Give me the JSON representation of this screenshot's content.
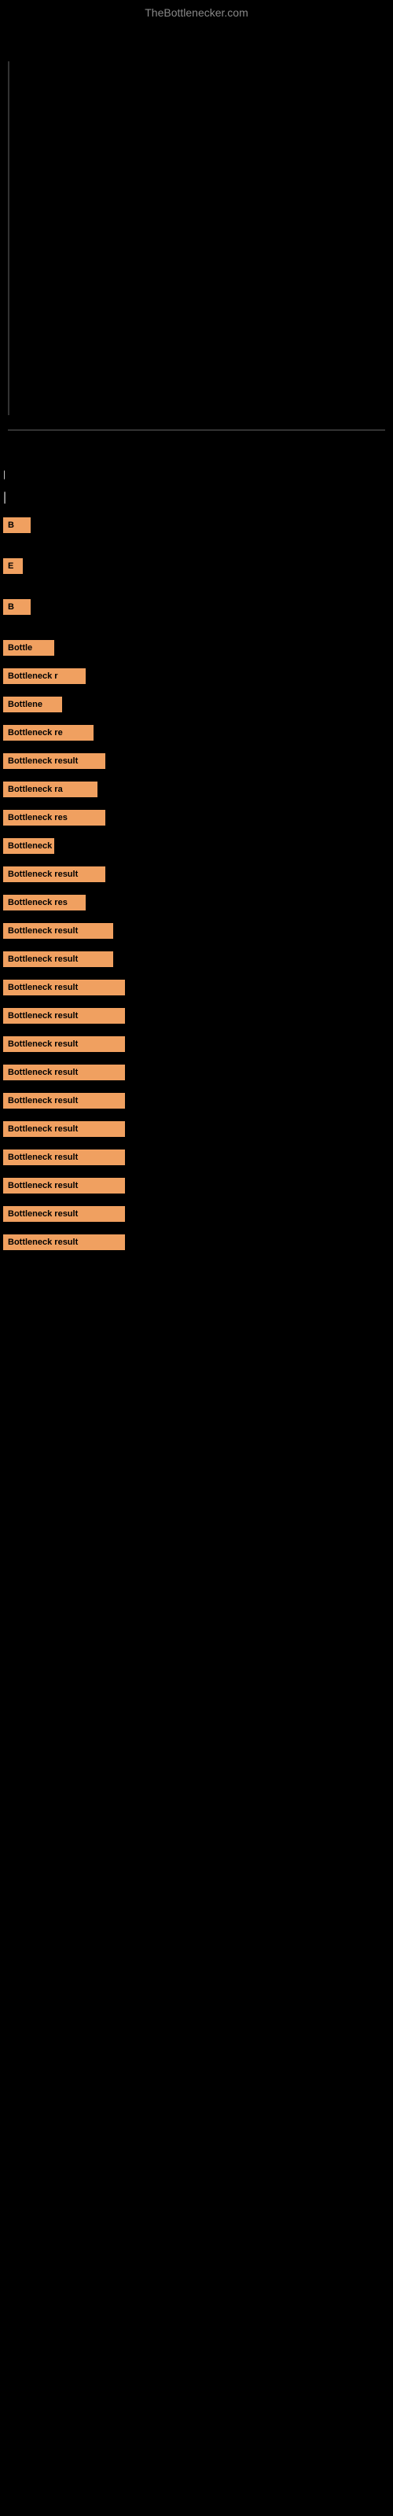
{
  "header": {
    "site_title": "TheBottlenecker.com"
  },
  "bars": [
    {
      "id": 1,
      "label": "B",
      "width_class": "bar-w1",
      "gap": "large"
    },
    {
      "id": 2,
      "label": "E",
      "width_class": "bar-w2",
      "gap": "large"
    },
    {
      "id": 3,
      "label": "B",
      "width_class": "bar-w3",
      "gap": "large"
    },
    {
      "id": 4,
      "label": "Bottle",
      "width_class": "bar-w4",
      "gap": "medium"
    },
    {
      "id": 5,
      "label": "Bottleneck r",
      "width_class": "bar-w5",
      "gap": "medium"
    },
    {
      "id": 6,
      "label": "Bottlene",
      "width_class": "bar-w6",
      "gap": "medium"
    },
    {
      "id": 7,
      "label": "Bottleneck re",
      "width_class": "bar-w7",
      "gap": "medium"
    },
    {
      "id": 8,
      "label": "Bottleneck result",
      "width_class": "bar-w8",
      "gap": "medium"
    },
    {
      "id": 9,
      "label": "Bottleneck ra",
      "width_class": "bar-w9",
      "gap": "medium"
    },
    {
      "id": 10,
      "label": "Bottleneck res",
      "width_class": "bar-w10",
      "gap": "medium"
    },
    {
      "id": 11,
      "label": "Bottleneck",
      "width_class": "bar-w11",
      "gap": "medium"
    },
    {
      "id": 12,
      "label": "Bottleneck result",
      "width_class": "bar-w12",
      "gap": "medium"
    },
    {
      "id": 13,
      "label": "Bottleneck res",
      "width_class": "bar-w13",
      "gap": "medium"
    },
    {
      "id": 14,
      "label": "Bottleneck result",
      "width_class": "bar-w14",
      "gap": "medium"
    },
    {
      "id": 15,
      "label": "Bottleneck result",
      "width_class": "bar-w15",
      "gap": "medium"
    },
    {
      "id": 16,
      "label": "Bottleneck result",
      "width_class": "bar-w16",
      "gap": "medium"
    },
    {
      "id": 17,
      "label": "Bottleneck result",
      "width_class": "bar-w17",
      "gap": "medium"
    },
    {
      "id": 18,
      "label": "Bottleneck result",
      "width_class": "bar-w18",
      "gap": "medium"
    },
    {
      "id": 19,
      "label": "Bottleneck result",
      "width_class": "bar-w19",
      "gap": "medium"
    },
    {
      "id": 20,
      "label": "Bottleneck result",
      "width_class": "bar-w20",
      "gap": "medium"
    },
    {
      "id": 21,
      "label": "Bottleneck result",
      "width_class": "bar-w21",
      "gap": "medium"
    },
    {
      "id": 22,
      "label": "Bottleneck result",
      "width_class": "bar-w22",
      "gap": "medium"
    },
    {
      "id": 23,
      "label": "Bottleneck result",
      "width_class": "bar-w23",
      "gap": "medium"
    },
    {
      "id": 24,
      "label": "Bottleneck result",
      "width_class": "bar-w24",
      "gap": "medium"
    },
    {
      "id": 25,
      "label": "Bottleneck result",
      "width_class": "bar-w25",
      "gap": "medium"
    }
  ]
}
